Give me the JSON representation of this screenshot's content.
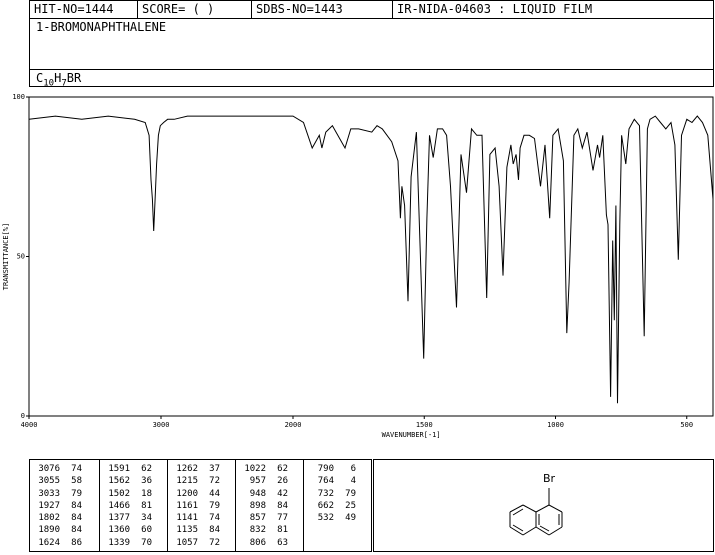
{
  "header": {
    "hit_no": "HIT-NO=1444",
    "score": "SCORE=  (   )",
    "sdbs_no": "SDBS-NO=1443",
    "ir_id": "IR-NIDA-04603 : LIQUID FILM",
    "compound_name": "1-BROMONAPHTHALENE",
    "formula_c": "C",
    "formula_c_sub": "10",
    "formula_h": "H",
    "formula_h_sub": "7",
    "formula_rest": "BR"
  },
  "chart_data": {
    "type": "line",
    "xlabel": "WAVENUMBER[-1]",
    "ylabel": "TRANSMITTANCE[%]",
    "xlim": [
      4000,
      400
    ],
    "ylim": [
      0,
      100
    ],
    "x_ticks": [
      4000,
      3000,
      2000,
      1500,
      1000,
      500
    ],
    "x_tick_labels": [
      "4000",
      "3000",
      "2000",
      "1500",
      "1000",
      "500"
    ],
    "y_ticks": [
      0,
      50,
      100
    ],
    "y_tick_labels": [
      "0",
      "50",
      "100"
    ],
    "grid": false,
    "series": [
      {
        "x": [
          4000,
          3800,
          3600,
          3400,
          3200,
          3120,
          3090,
          3076,
          3065,
          3055,
          3045,
          3033,
          3020,
          3005,
          2980,
          2950,
          2900,
          2800,
          2600,
          2400,
          2200,
          2000,
          1960,
          1927,
          1900,
          1890,
          1875,
          1850,
          1802,
          1780,
          1750,
          1700,
          1680,
          1660,
          1624,
          1600,
          1591,
          1585,
          1575,
          1562,
          1550,
          1530,
          1502,
          1490,
          1480,
          1466,
          1450,
          1430,
          1415,
          1400,
          1377,
          1360,
          1339,
          1320,
          1300,
          1280,
          1262,
          1250,
          1230,
          1215,
          1200,
          1185,
          1170,
          1161,
          1150,
          1141,
          1135,
          1120,
          1100,
          1080,
          1057,
          1040,
          1022,
          1010,
          990,
          970,
          957,
          948,
          930,
          915,
          898,
          880,
          857,
          840,
          832,
          820,
          806,
          800,
          790,
          782,
          776,
          770,
          764,
          755,
          748,
          732,
          720,
          700,
          680,
          662,
          650,
          640,
          620,
          600,
          580,
          560,
          545,
          532,
          520,
          500,
          480,
          460,
          440,
          420,
          400
        ],
        "y": [
          93,
          94,
          93,
          94,
          93,
          92,
          88,
          74,
          68,
          58,
          68,
          79,
          88,
          91,
          92,
          93,
          93,
          94,
          94,
          94,
          94,
          94,
          92,
          84,
          88,
          84,
          89,
          91,
          84,
          90,
          90,
          89,
          91,
          90,
          86,
          80,
          62,
          72,
          66,
          36,
          75,
          89,
          18,
          62,
          88,
          81,
          90,
          90,
          88,
          72,
          34,
          82,
          70,
          90,
          88,
          88,
          37,
          82,
          84,
          72,
          44,
          78,
          85,
          79,
          82,
          74,
          84,
          88,
          88,
          87,
          72,
          85,
          62,
          88,
          90,
          80,
          26,
          42,
          88,
          90,
          84,
          89,
          77,
          85,
          81,
          88,
          63,
          60,
          6,
          55,
          30,
          66,
          4,
          60,
          88,
          79,
          90,
          93,
          91,
          25,
          90,
          93,
          94,
          92,
          90,
          92,
          85,
          49,
          88,
          93,
          92,
          94,
          92,
          88,
          68
        ]
      }
    ]
  },
  "peak_table": {
    "columns": [
      [
        [
          "3076",
          "74"
        ],
        [
          "3055",
          "58"
        ],
        [
          "3033",
          "79"
        ],
        [
          "1927",
          "84"
        ],
        [
          "1802",
          "84"
        ],
        [
          "1890",
          "84"
        ],
        [
          "1624",
          "86"
        ]
      ],
      [
        [
          "1591",
          "62"
        ],
        [
          "1562",
          "36"
        ],
        [
          "1502",
          "18"
        ],
        [
          "1466",
          "81"
        ],
        [
          "1377",
          "34"
        ],
        [
          "1360",
          "60"
        ],
        [
          "1339",
          "70"
        ]
      ],
      [
        [
          "1262",
          "37"
        ],
        [
          "1215",
          "72"
        ],
        [
          "1200",
          "44"
        ],
        [
          "1161",
          "79"
        ],
        [
          "1141",
          "74"
        ],
        [
          "1135",
          "84"
        ],
        [
          "1057",
          "72"
        ]
      ],
      [
        [
          "1022",
          "62"
        ],
        [
          "957",
          "26"
        ],
        [
          "948",
          "42"
        ],
        [
          "898",
          "84"
        ],
        [
          "857",
          "77"
        ],
        [
          "832",
          "81"
        ],
        [
          "806",
          "63"
        ]
      ],
      [
        [
          "790",
          "6"
        ],
        [
          "764",
          "4"
        ],
        [
          "732",
          "79"
        ],
        [
          "662",
          "25"
        ],
        [
          "532",
          "49"
        ]
      ]
    ]
  },
  "structure": {
    "substituent": "Br"
  }
}
